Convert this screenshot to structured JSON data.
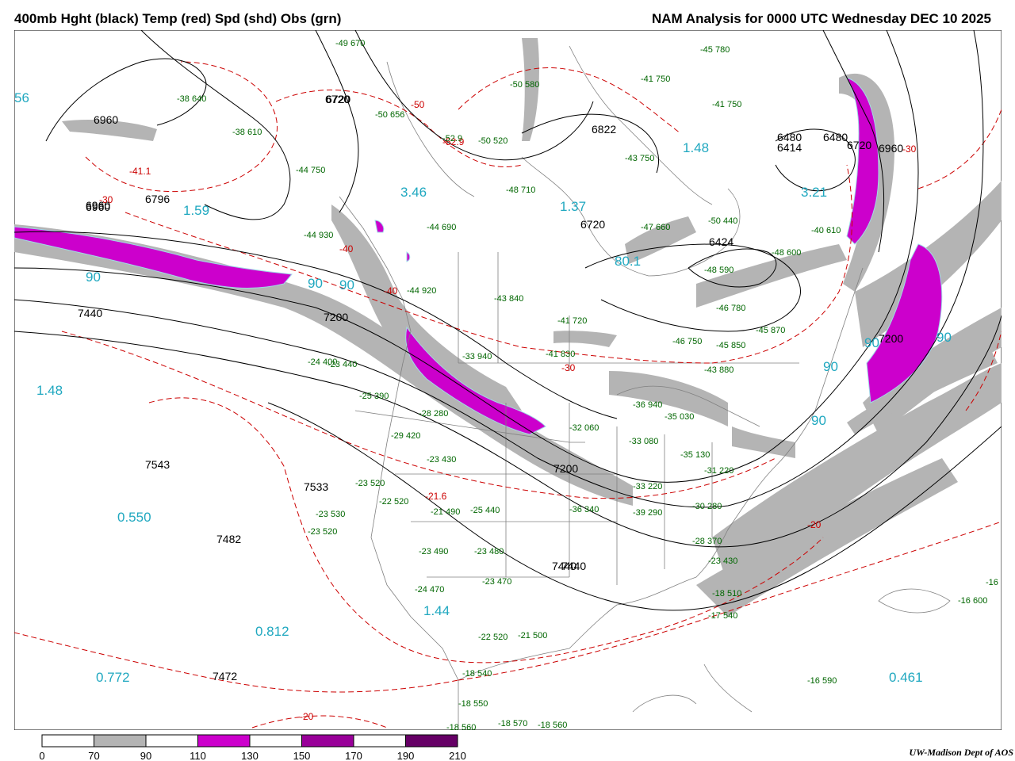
{
  "header": {
    "left_title": "400mb Hght (black) Temp (red) Spd (shd) Obs (grn)",
    "right_title": "NAM Analysis for 0000 UTC Wednesday  DEC 10 2025"
  },
  "colors": {
    "height_contour": "#000000",
    "temperature_contour": "#cc0000",
    "speed_label": "#20a8c0",
    "observation": "#006600",
    "boundary": "#808080",
    "speed_shades": [
      "#ffffff",
      "#b4b4b4",
      "#ffffff",
      "#cc00cc",
      "#ffffff",
      "#990099",
      "#ffffff",
      "#660066"
    ]
  },
  "height_labels": [
    "6960",
    "6720",
    "6960",
    "6796",
    "6960",
    "7440",
    "7200",
    "7440",
    "7543",
    "7533",
    "7482",
    "7472",
    "6720",
    "6822",
    "6720",
    "6424",
    "6480",
    "6414",
    "6480",
    "6720",
    "6960",
    "7200",
    "7200",
    "7440"
  ],
  "speed_labels": [
    "56",
    "3.46",
    "1.59",
    "1.37",
    "1.48",
    "80.1",
    "3.21",
    "1.48",
    "0.550",
    "0.812",
    "0.772",
    "1.44",
    "0.461",
    "90",
    "90",
    "90",
    "90",
    "90",
    "90",
    "90"
  ],
  "temp_labels": [
    "-41.1",
    "-30",
    "-52.9",
    "-50",
    "-40",
    "-40",
    "-30",
    "-20",
    "-21.6",
    "-20",
    "-30"
  ],
  "obs_labels": [
    "-49 670",
    "-38 640",
    "-38 610",
    "-44 750",
    "-50 656",
    "-50 580",
    "-52.9",
    "-50 520",
    "-48 710",
    "-41 750",
    "-43 750",
    "-45 780",
    "-44 690",
    "-44 930",
    "-41 750",
    "-44 920",
    "-43 840",
    "-41 720",
    "-41 830",
    "-33 940",
    "-23 440",
    "-25 390",
    "-24 400",
    "-28 280",
    "-29 420",
    "-23 430",
    "-23 520",
    "-22 520",
    "-23 530",
    "-23 520",
    "-21 490",
    "-23 490",
    "-23 480",
    "-25 440",
    "-23 470",
    "-24 470",
    "-22 520",
    "-21 500",
    "-18 540",
    "-18 550",
    "-18 560",
    "-18 570",
    "-18 560",
    "-33 080",
    "-30 280",
    "-28 370",
    "-23 430",
    "-18 510",
    "-17 540",
    "-16 590",
    "-16 600",
    "-16",
    "-46 750",
    "-45 850",
    "-43 880",
    "-40 610",
    "-48 600",
    "-50 440",
    "-47 660",
    "-48 590",
    "-46 780",
    "-45 870",
    "-36 940",
    "-32 060",
    "-35 030",
    "-35 130",
    "-31 220",
    "-33 220",
    "-36 340",
    "-39 290"
  ],
  "legend": {
    "ticks": [
      "0",
      "70",
      "90",
      "110",
      "130",
      "150",
      "170",
      "190",
      "210"
    ]
  },
  "credit": "UW-Madison  Dept of AOS"
}
